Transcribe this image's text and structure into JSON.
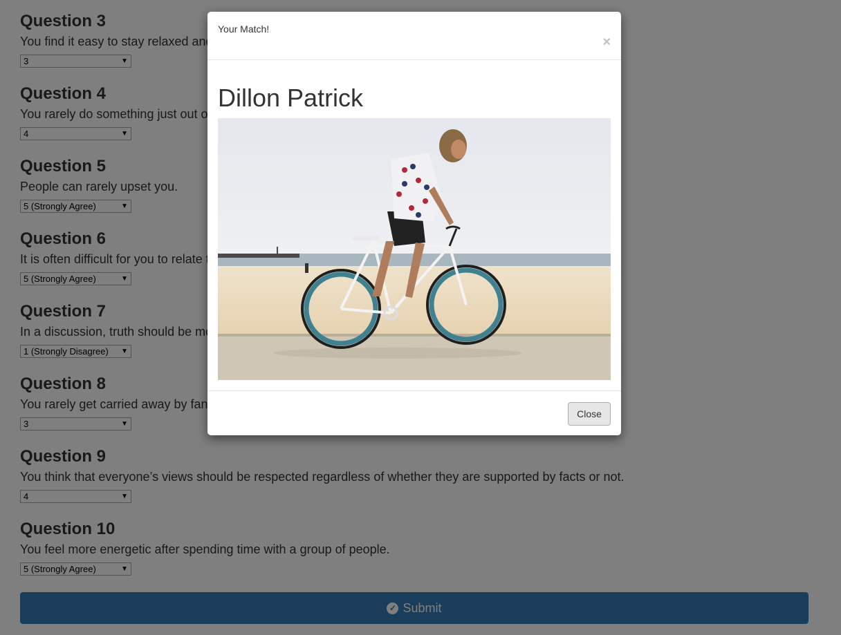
{
  "questions": [
    {
      "title": "Question 3",
      "text": "You find it easy to stay relaxed and",
      "selected": "3"
    },
    {
      "title": "Question 4",
      "text": "You rarely do something just out o",
      "selected": "4"
    },
    {
      "title": "Question 5",
      "text": "People can rarely upset you.",
      "selected": "5 (Strongly Agree)"
    },
    {
      "title": "Question 6",
      "text": "It is often difficult for you to relate t",
      "selected": "5 (Strongly Agree)"
    },
    {
      "title": "Question 7",
      "text": "In a discussion, truth should be mo",
      "selected": "1 (Strongly Disagree)"
    },
    {
      "title": "Question 8",
      "text": "You rarely get carried away by fan",
      "selected": "3"
    },
    {
      "title": "Question 9",
      "text": "You think that everyone’s views should be respected regardless of whether they are supported by facts or not.",
      "selected": "4"
    },
    {
      "title": "Question 10",
      "text": "You feel more energetic after spending time with a group of people.",
      "selected": "5 (Strongly Agree)"
    }
  ],
  "submit": {
    "label": "Submit",
    "icon": "check-circle-icon"
  },
  "modal": {
    "title": "Your Match!",
    "close_x": "×",
    "name": "Dillon Patrick",
    "photo_alt": "",
    "close_label": "Close"
  },
  "colors": {
    "primary": "#337ab7",
    "backdrop": "rgba(0,0,0,0.5)",
    "default_button": "#e6e6e6"
  }
}
